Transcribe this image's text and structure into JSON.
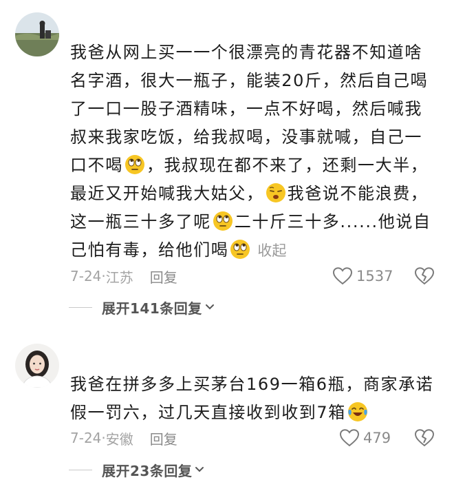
{
  "comments": [
    {
      "avatar": "landscape-avatar",
      "text_parts": [
        "我爸从网上买一一个很漂亮的青花器不知道啥名字酒，很大一瓶子，能装20斤，然后自己喝了一口一股子酒精味，一点不好喝，然后喊我叔来我家吃饭，给我叔喝，没事就喊，自己一口不喝",
        "，我叔现在都不来了，还剩一大半，最近又开始喊我大姑父，",
        "我爸说不能浪费，这一瓶三十多了呢",
        "二十斤三十多......他说自己怕有毒，给他们喝"
      ],
      "emojis": [
        "rolling-eyes-emoji",
        "tired-face-emoji",
        "rolling-eyes-emoji",
        "rolling-eyes-emoji"
      ],
      "collapse_label": "收起",
      "date": "7-24",
      "location": "江苏",
      "reply_label": "回复",
      "likes": "1537",
      "expand_label": "展开141条回复"
    },
    {
      "avatar": "woman-portrait-avatar",
      "text_parts": [
        "我爸在拼多多上买茅台169一箱6瓶，商家承诺假一罚六，过几天直接收到收到7箱"
      ],
      "emojis": [
        "laughing-tears-emoji"
      ],
      "date": "7-24",
      "location": "安徽",
      "reply_label": "回复",
      "likes": "479",
      "expand_label": "展开23条回复"
    }
  ],
  "colors": {
    "text": "#1c1c1c",
    "meta": "#a3a3a3",
    "emoji_yellow": "#f7c624"
  }
}
